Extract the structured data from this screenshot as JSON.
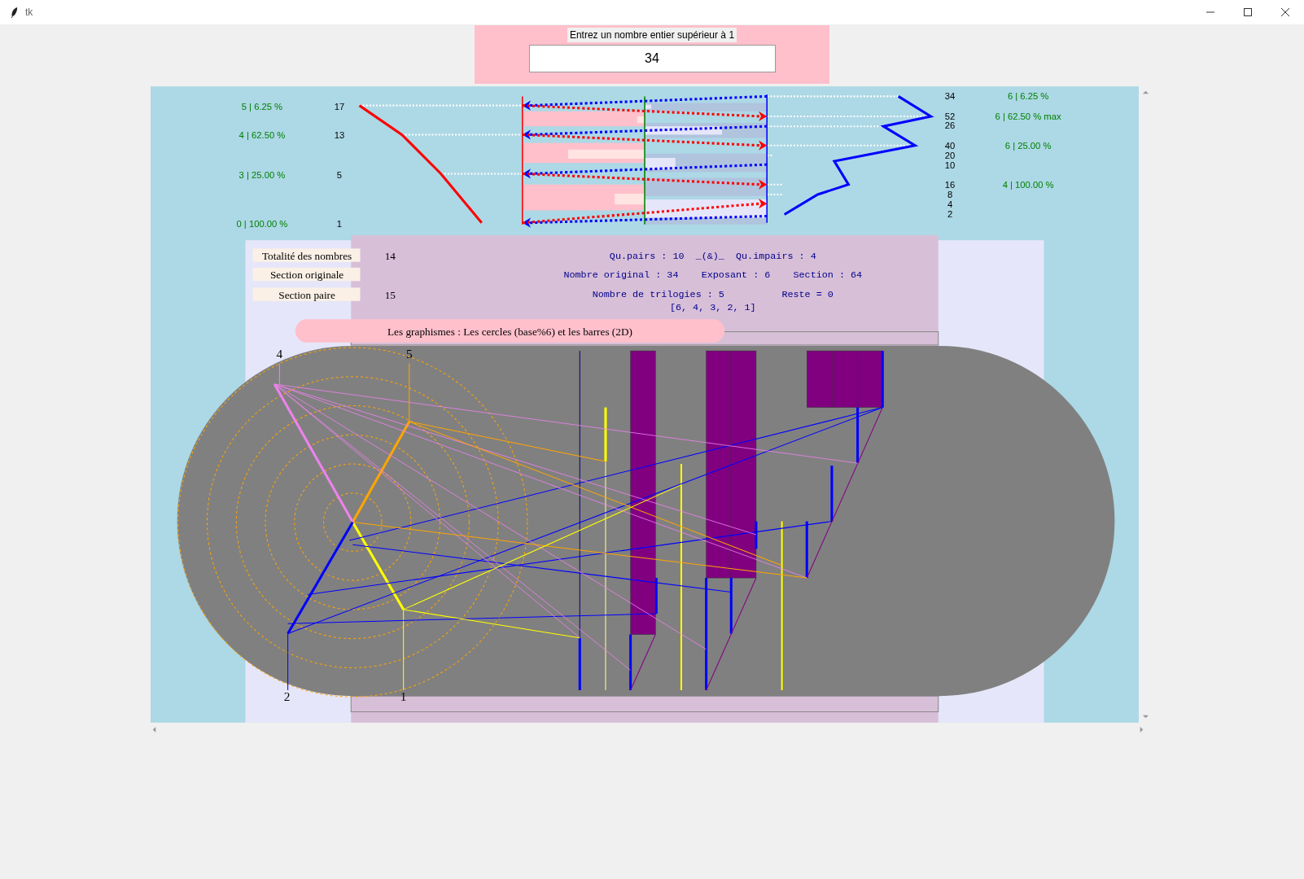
{
  "window": {
    "title": "tk"
  },
  "entry": {
    "prompt": "Entrez un nombre entier supérieur à 1",
    "value": "34"
  },
  "left_labels": [
    {
      "ratio": "5 | 6.25 %",
      "number": "17"
    },
    {
      "ratio": "4 | 62.50 %",
      "number": "13"
    },
    {
      "ratio": "3 | 25.00 %",
      "number": "5"
    },
    {
      "ratio": "0 | 100.00 %",
      "number": "1"
    }
  ],
  "right_numbers": [
    "34",
    "52",
    "26",
    "40",
    "20",
    "10",
    "16",
    "8",
    "4",
    "2"
  ],
  "right_ratios": [
    "6 | 6.25 %",
    "6 | 62.50 % max",
    "6 | 25.00 %",
    "4 | 100.00 %"
  ],
  "summary": [
    {
      "label": "Totalité des nombres",
      "value": "14"
    },
    {
      "label": "Section originale"
    },
    {
      "label": "Section paire",
      "value": "15"
    }
  ],
  "stats": [
    "Qu.pairs : 10  _(&)_  Qu.impairs : 4",
    "Nombre original : 34    Exposant : 6    Section : 64",
    "Nombre de trilogies : 5          Reste = 0",
    "[6, 4, 3, 2, 1]"
  ],
  "graphics_title": "Les graphismes : Les cercles (base%6) et les barres (2D)",
  "axis_labels": [
    "4",
    "5",
    "2",
    "1"
  ]
}
